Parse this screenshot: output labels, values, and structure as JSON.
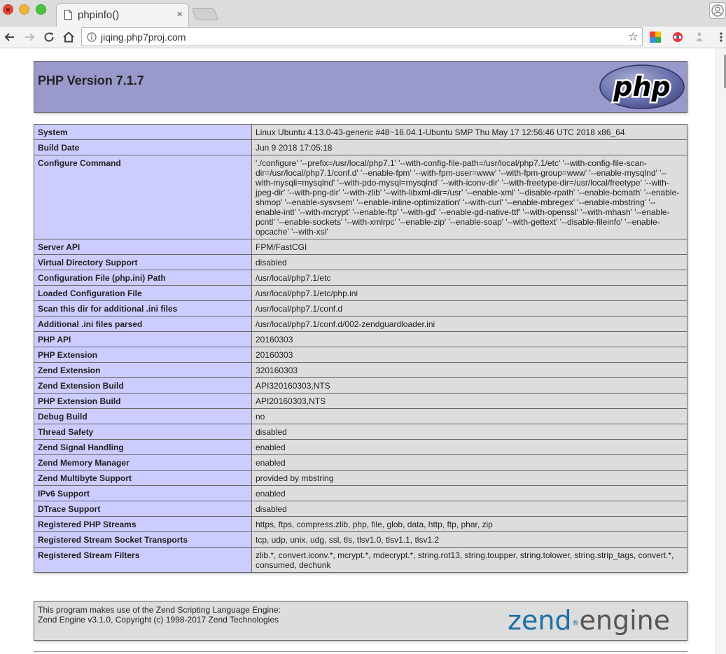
{
  "window": {
    "tab_title": "phpinfo()",
    "tab_close": "×"
  },
  "toolbar": {
    "url": "jiqing.php7proj.com"
  },
  "header": {
    "title": "PHP Version 7.1.7"
  },
  "rows": [
    {
      "label": "System",
      "value": "Linux Ubuntu 4.13.0-43-generic #48~16.04.1-Ubuntu SMP Thu May 17 12:56:46 UTC 2018 x86_64"
    },
    {
      "label": "Build Date",
      "value": "Jun 9 2018 17:05:18"
    },
    {
      "label": "Configure Command",
      "value": "'./configure' '--prefix=/usr/local/php7.1' '--with-config-file-path=/usr/local/php7.1/etc' '--with-config-file-scan-dir=/usr/local/php7.1/conf.d' '--enable-fpm' '--with-fpm-user=www' '--with-fpm-group=www' '--enable-mysqlnd' '--with-mysqli=mysqlnd' '--with-pdo-mysql=mysqlnd' '--with-iconv-dir' '--with-freetype-dir=/usr/local/freetype' '--with-jpeg-dir' '--with-png-dir' '--with-zlib' '--with-libxml-dir=/usr' '--enable-xml' '--disable-rpath' '--enable-bcmath' '--enable-shmop' '--enable-sysvsem' '--enable-inline-optimization' '--with-curl' '--enable-mbregex' '--enable-mbstring' '--enable-intl' '--with-mcrypt' '--enable-ftp' '--with-gd' '--enable-gd-native-ttf' '--with-openssl' '--with-mhash' '--enable-pcntl' '--enable-sockets' '--with-xmlrpc' '--enable-zip' '--enable-soap' '--with-gettext' '--disable-fileinfo' '--enable-opcache' '--with-xsl'"
    },
    {
      "label": "Server API",
      "value": "FPM/FastCGI"
    },
    {
      "label": "Virtual Directory Support",
      "value": "disabled"
    },
    {
      "label": "Configuration File (php.ini) Path",
      "value": "/usr/local/php7.1/etc"
    },
    {
      "label": "Loaded Configuration File",
      "value": "/usr/local/php7.1/etc/php.ini"
    },
    {
      "label": "Scan this dir for additional .ini files",
      "value": "/usr/local/php7.1/conf.d"
    },
    {
      "label": "Additional .ini files parsed",
      "value": "/usr/local/php7.1/conf.d/002-zendguardloader.ini"
    },
    {
      "label": "PHP API",
      "value": "20160303"
    },
    {
      "label": "PHP Extension",
      "value": "20160303"
    },
    {
      "label": "Zend Extension",
      "value": "320160303"
    },
    {
      "label": "Zend Extension Build",
      "value": "API320160303,NTS"
    },
    {
      "label": "PHP Extension Build",
      "value": "API20160303,NTS"
    },
    {
      "label": "Debug Build",
      "value": "no"
    },
    {
      "label": "Thread Safety",
      "value": "disabled"
    },
    {
      "label": "Zend Signal Handling",
      "value": "enabled"
    },
    {
      "label": "Zend Memory Manager",
      "value": "enabled"
    },
    {
      "label": "Zend Multibyte Support",
      "value": "provided by mbstring"
    },
    {
      "label": "IPv6 Support",
      "value": "enabled"
    },
    {
      "label": "DTrace Support",
      "value": "disabled"
    },
    {
      "label": "Registered PHP Streams",
      "value": "https, ftps, compress.zlib, php, file, glob, data, http, ftp, phar, zip"
    },
    {
      "label": "Registered Stream Socket Transports",
      "value": "tcp, udp, unix, udg, ssl, tls, tlsv1.0, tlsv1.1, tlsv1.2"
    },
    {
      "label": "Registered Stream Filters",
      "value": "zlib.*, convert.iconv.*, mcrypt.*, mdecrypt.*, string.rot13, string.toupper, string.tolower, string.strip_tags, convert.*, consumed, dechunk"
    }
  ],
  "footer": {
    "line1": "This program makes use of the Zend Scripting Language Engine:",
    "line2": "Zend Engine v3.1.0, Copyright (c) 1998-2017 Zend Technologies",
    "logo_part1": "zend",
    "logo_part2": "engine"
  },
  "logo": {
    "php_text": "php"
  }
}
